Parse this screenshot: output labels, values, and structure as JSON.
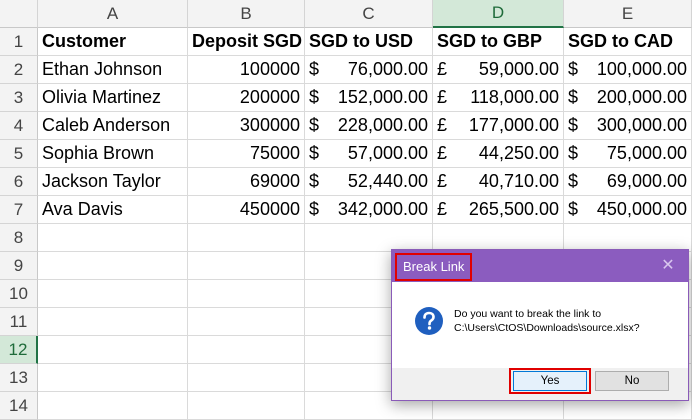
{
  "columns": [
    "A",
    "B",
    "C",
    "D",
    "E"
  ],
  "rows": [
    "1",
    "2",
    "3",
    "4",
    "5",
    "6",
    "7",
    "8",
    "9",
    "10",
    "11",
    "12",
    "13",
    "14"
  ],
  "headers": [
    "Customer",
    "Deposit SGD",
    "SGD to USD",
    "SGD to GBP",
    "SGD to CAD"
  ],
  "table": [
    {
      "customer": "Ethan Johnson",
      "deposit": "100000",
      "usd_sym": "$",
      "usd": "76,000.00",
      "gbp_sym": "£",
      "gbp": "59,000.00",
      "cad_sym": "$",
      "cad": "100,000.00"
    },
    {
      "customer": "Olivia Martinez",
      "deposit": "200000",
      "usd_sym": "$",
      "usd": "152,000.00",
      "gbp_sym": "£",
      "gbp": "118,000.00",
      "cad_sym": "$",
      "cad": "200,000.00"
    },
    {
      "customer": "Caleb Anderson",
      "deposit": "300000",
      "usd_sym": "$",
      "usd": "228,000.00",
      "gbp_sym": "£",
      "gbp": "177,000.00",
      "cad_sym": "$",
      "cad": "300,000.00"
    },
    {
      "customer": "Sophia Brown",
      "deposit": "75000",
      "usd_sym": "$",
      "usd": "57,000.00",
      "gbp_sym": "£",
      "gbp": "44,250.00",
      "cad_sym": "$",
      "cad": "75,000.00"
    },
    {
      "customer": "Jackson Taylor",
      "deposit": "69000",
      "usd_sym": "$",
      "usd": "52,440.00",
      "gbp_sym": "£",
      "gbp": "40,710.00",
      "cad_sym": "$",
      "cad": "69,000.00"
    },
    {
      "customer": "Ava Davis",
      "deposit": "450000",
      "usd_sym": "$",
      "usd": "342,000.00",
      "gbp_sym": "£",
      "gbp": "265,500.00",
      "cad_sym": "$",
      "cad": "450,000.00"
    }
  ],
  "active_column": "D",
  "active_row": "12",
  "dialog": {
    "title": "Break Link",
    "close_glyph": "✕",
    "message_line1": "Do you want to break the link to",
    "message_line2": "C:\\Users\\CtOS\\Downloads\\source.xlsx?",
    "icon": "question-icon",
    "yes_label": "Yes",
    "no_label": "No"
  },
  "colors": {
    "titlebar": "#8b5cbf",
    "highlight": "#e00000",
    "active_header": "#217346"
  }
}
